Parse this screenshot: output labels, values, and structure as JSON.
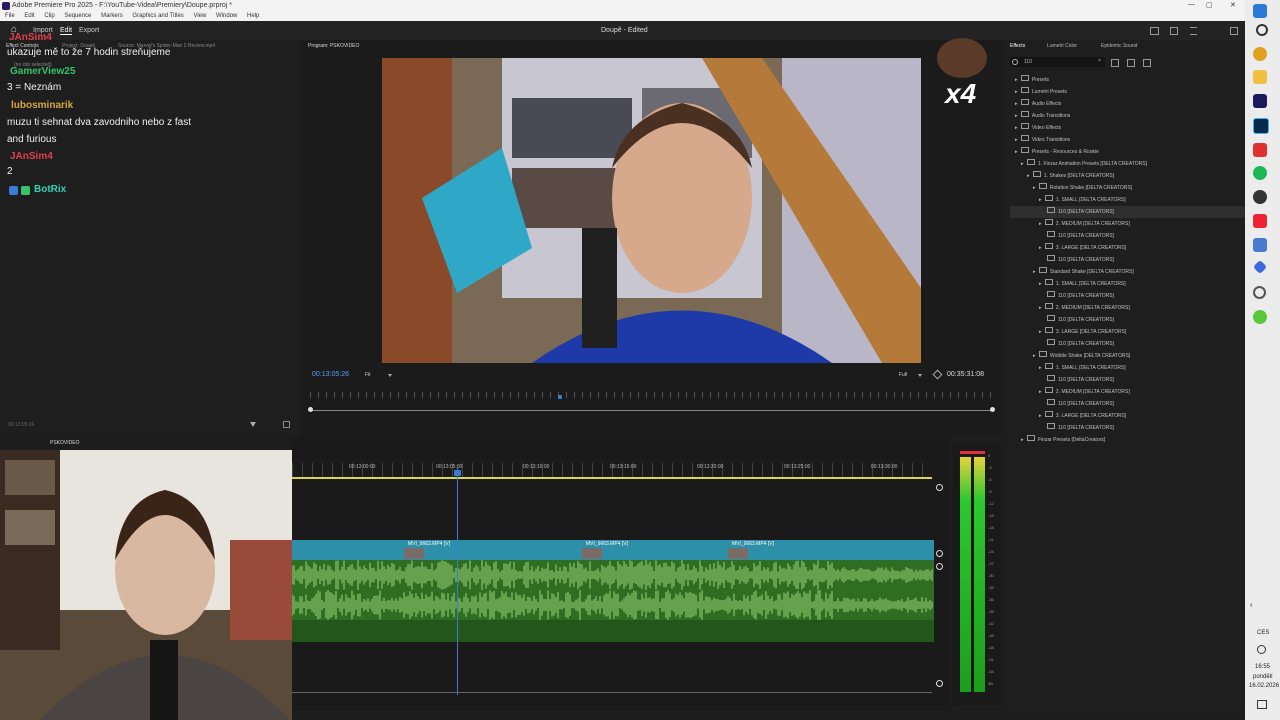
{
  "titlebar": {
    "title": "Adobe Premiere Pro 2025 - F:\\YouTube-Videa\\Premiery\\Doupe.prproj *",
    "controls": [
      "—",
      "▢",
      "✕"
    ]
  },
  "menubar": {
    "items": [
      "File",
      "Edit",
      "Clip",
      "Sequence",
      "Markers",
      "Graphics and Titles",
      "View",
      "Window",
      "Help"
    ]
  },
  "header": {
    "home": "⌂",
    "tabs": [
      "Import",
      "Edit",
      "Export"
    ],
    "project_title": "Doupě - Edited"
  },
  "left_panel": {
    "tabs": [
      "Effect Controls",
      "Project: Doupě",
      "Source: Marvel's Spider-Man 2 Review.mp4"
    ],
    "no_clip": "(no clip selected)",
    "timecode": "00:13:05:26"
  },
  "chat": [
    {
      "user": "JAnSim4",
      "color": "#e0404a",
      "msg": "ukazuje mě to že 7 hodin streňujeme"
    },
    {
      "user": "GamerView25",
      "color": "#34c26a",
      "msg": "3 = Neznám"
    },
    {
      "user": "lubosminarik",
      "color": "#d8a640",
      "msg": "muzu ti sehnat dva zavodniho nebo z fast and furious"
    },
    {
      "user": "JAnSim4",
      "color": "#e0404a",
      "msg": "2"
    },
    {
      "user": "BotRix",
      "color": "#33d0b6",
      "msg": ""
    }
  ],
  "program": {
    "tab": "Program: PSKOVIDEO",
    "timecode": "00:13:05:26",
    "fit": "Fit",
    "quality": "Full",
    "duration": "00:35:31:08",
    "overlay": "x4"
  },
  "effects": {
    "tabs": [
      "Effects",
      "Lumetri Color",
      "Epidemic Sound"
    ],
    "search_value": "110",
    "tree": [
      {
        "label": "Presets",
        "level": 0
      },
      {
        "label": "Lumetri Presets",
        "level": 0
      },
      {
        "label": "Audio Effects",
        "level": 0
      },
      {
        "label": "Audio Transitions",
        "level": 0
      },
      {
        "label": "Video Effects",
        "level": 0
      },
      {
        "label": "Video Transitions",
        "level": 0
      },
      {
        "label": "Presets - Resources & Rookie",
        "level": 0
      },
      {
        "label": "1. Finzar Animation Presets [DELTA CREATORS]",
        "level": 1
      },
      {
        "label": "1. Shakes [DELTA CREATORS]",
        "level": 2
      },
      {
        "label": "Rotation Shake [DELTA CREATORS]",
        "level": 3
      },
      {
        "label": "1. SMALL [DELTA CREATORS]",
        "level": 4
      },
      {
        "label": "110 [DELTA CREATORS]",
        "level": 5
      },
      {
        "label": "2. MEDIUM [DELTA CREATORS]",
        "level": 4
      },
      {
        "label": "110 [DELTA CREATORS]",
        "level": 5
      },
      {
        "label": "3. LARGE [DELTA CREATORS]",
        "level": 4
      },
      {
        "label": "110 [DELTA CREATORS]",
        "level": 5
      },
      {
        "label": "Standard Shake [DELTA CREATORS]",
        "level": 3
      },
      {
        "label": "1. SMALL [DELTA CREATORS]",
        "level": 4
      },
      {
        "label": "110 [DELTA CREATORS]",
        "level": 5
      },
      {
        "label": "2. MEDIUM [DELTA CREATORS]",
        "level": 4
      },
      {
        "label": "110 [DELTA CREATORS]",
        "level": 5
      },
      {
        "label": "3. LARGE [DELTA CREATORS]",
        "level": 4
      },
      {
        "label": "110 [DELTA CREATORS]",
        "level": 5
      },
      {
        "label": "Wobble Shake [DELTA CREATORS]",
        "level": 3
      },
      {
        "label": "1. SMALL [DELTA CREATORS]",
        "level": 4
      },
      {
        "label": "110 [DELTA CREATORS]",
        "level": 5
      },
      {
        "label": "2. MEDIUM [DELTA CREATORS]",
        "level": 4
      },
      {
        "label": "110 [DELTA CREATORS]",
        "level": 5
      },
      {
        "label": "3. LARGE [DELTA CREATORS]",
        "level": 4
      },
      {
        "label": "110 [DELTA CREATORS]",
        "level": 5
      },
      {
        "label": "Finzar Presets [DeltaCreators]",
        "level": 1
      }
    ]
  },
  "timeline": {
    "tab": "PSKOVIDEO",
    "ruler": [
      "00:13:00:00",
      "00:13:05:00",
      "00:13:10:00",
      "00:13:15:00",
      "00:13:20:00",
      "00:13:25:00",
      "00:13:30:00"
    ],
    "clips": [
      "MVI_9663.MP4 [V]",
      "MVI_9663.MP4 [V]",
      "MVI_9663.MP4 [V]"
    ]
  },
  "meter": {
    "labels": [
      "0",
      "-3",
      "-6",
      "-9",
      "-12",
      "-15",
      "-18",
      "-21",
      "-24",
      "-27",
      "-30",
      "-33",
      "-36",
      "-39",
      "-42",
      "-45",
      "-48",
      "-51",
      "-54",
      "dB"
    ]
  },
  "taskbar": {
    "lang": "CES",
    "time": "16:55",
    "day": "pondělí",
    "date": "16.02.2026"
  },
  "colors": {
    "clip_blue": "#2d8fa8",
    "audio_green": "#3c8c2a",
    "playhead": "#3a7bd5",
    "meter_green": "#2ec82e"
  }
}
